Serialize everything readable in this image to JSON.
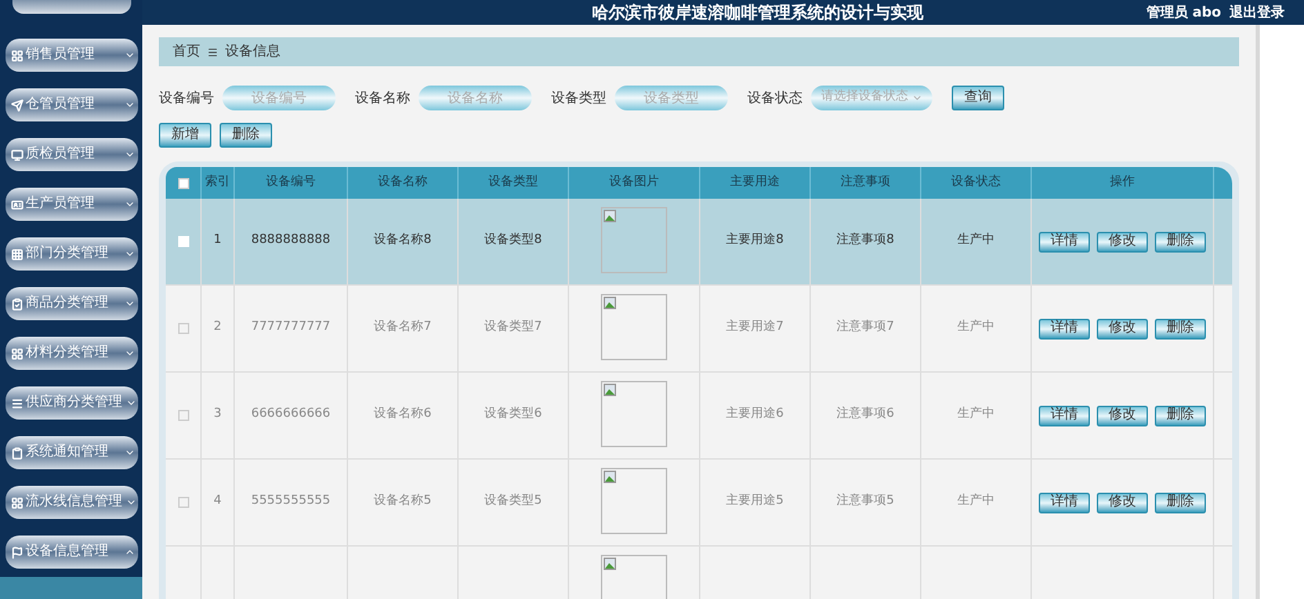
{
  "header": {
    "title": "哈尔滨市彼岸速溶咖啡管理系统的设计与实现",
    "user": "管理员 abo",
    "logout": "退出登录"
  },
  "sidebar": {
    "items": [
      {
        "label": "销售员管理",
        "expanded": false
      },
      {
        "label": "仓管员管理",
        "expanded": false
      },
      {
        "label": "质检员管理",
        "expanded": false
      },
      {
        "label": "生产员管理",
        "expanded": false
      },
      {
        "label": "部门分类管理",
        "expanded": false
      },
      {
        "label": "商品分类管理",
        "expanded": false
      },
      {
        "label": "材料分类管理",
        "expanded": false
      },
      {
        "label": "供应商分类管理",
        "expanded": false
      },
      {
        "label": "系统通知管理",
        "expanded": false
      },
      {
        "label": "流水线信息管理",
        "expanded": false
      },
      {
        "label": "设备信息管理",
        "expanded": true
      }
    ]
  },
  "breadcrumb": [
    "首页",
    "设备信息"
  ],
  "search": {
    "fields": [
      {
        "label": "设备编号",
        "placeholder": "设备编号",
        "kind": "input"
      },
      {
        "label": "设备名称",
        "placeholder": "设备名称",
        "kind": "input"
      },
      {
        "label": "设备类型",
        "placeholder": "设备类型",
        "kind": "input"
      },
      {
        "label": "设备状态",
        "placeholder": "请选择设备状态",
        "kind": "select"
      }
    ],
    "button": "查询"
  },
  "actions": [
    "新增",
    "删除"
  ],
  "table": {
    "header_checked": false,
    "columns": [
      "索引",
      "设备编号",
      "设备名称",
      "设备类型",
      "设备图片",
      "主要用途",
      "注意事项",
      "设备状态",
      "操作"
    ],
    "rows": [
      {
        "selected": true,
        "checked": false,
        "cells": [
          "1",
          "8888888888",
          "设备名称8",
          "设备类型8",
          "主要用途8",
          "注意事项8",
          "生产中"
        ],
        "actions": [
          "详情",
          "修改",
          "删除"
        ]
      },
      {
        "selected": false,
        "checked": false,
        "cells": [
          "2",
          "7777777777",
          "设备名称7",
          "设备类型7",
          "主要用途7",
          "注意事项7",
          "生产中"
        ],
        "actions": [
          "详情",
          "修改",
          "删除"
        ]
      },
      {
        "selected": false,
        "checked": false,
        "cells": [
          "3",
          "6666666666",
          "设备名称6",
          "设备类型6",
          "主要用途6",
          "注意事项6",
          "生产中"
        ],
        "actions": [
          "详情",
          "修改",
          "删除"
        ]
      },
      {
        "selected": false,
        "checked": false,
        "cells": [
          "4",
          "5555555555",
          "设备名称5",
          "设备类型5",
          "主要用途5",
          "注意事项5",
          "生产中"
        ],
        "actions": [
          "详情",
          "修改",
          "删除"
        ]
      },
      {
        "selected": false
      }
    ]
  }
}
